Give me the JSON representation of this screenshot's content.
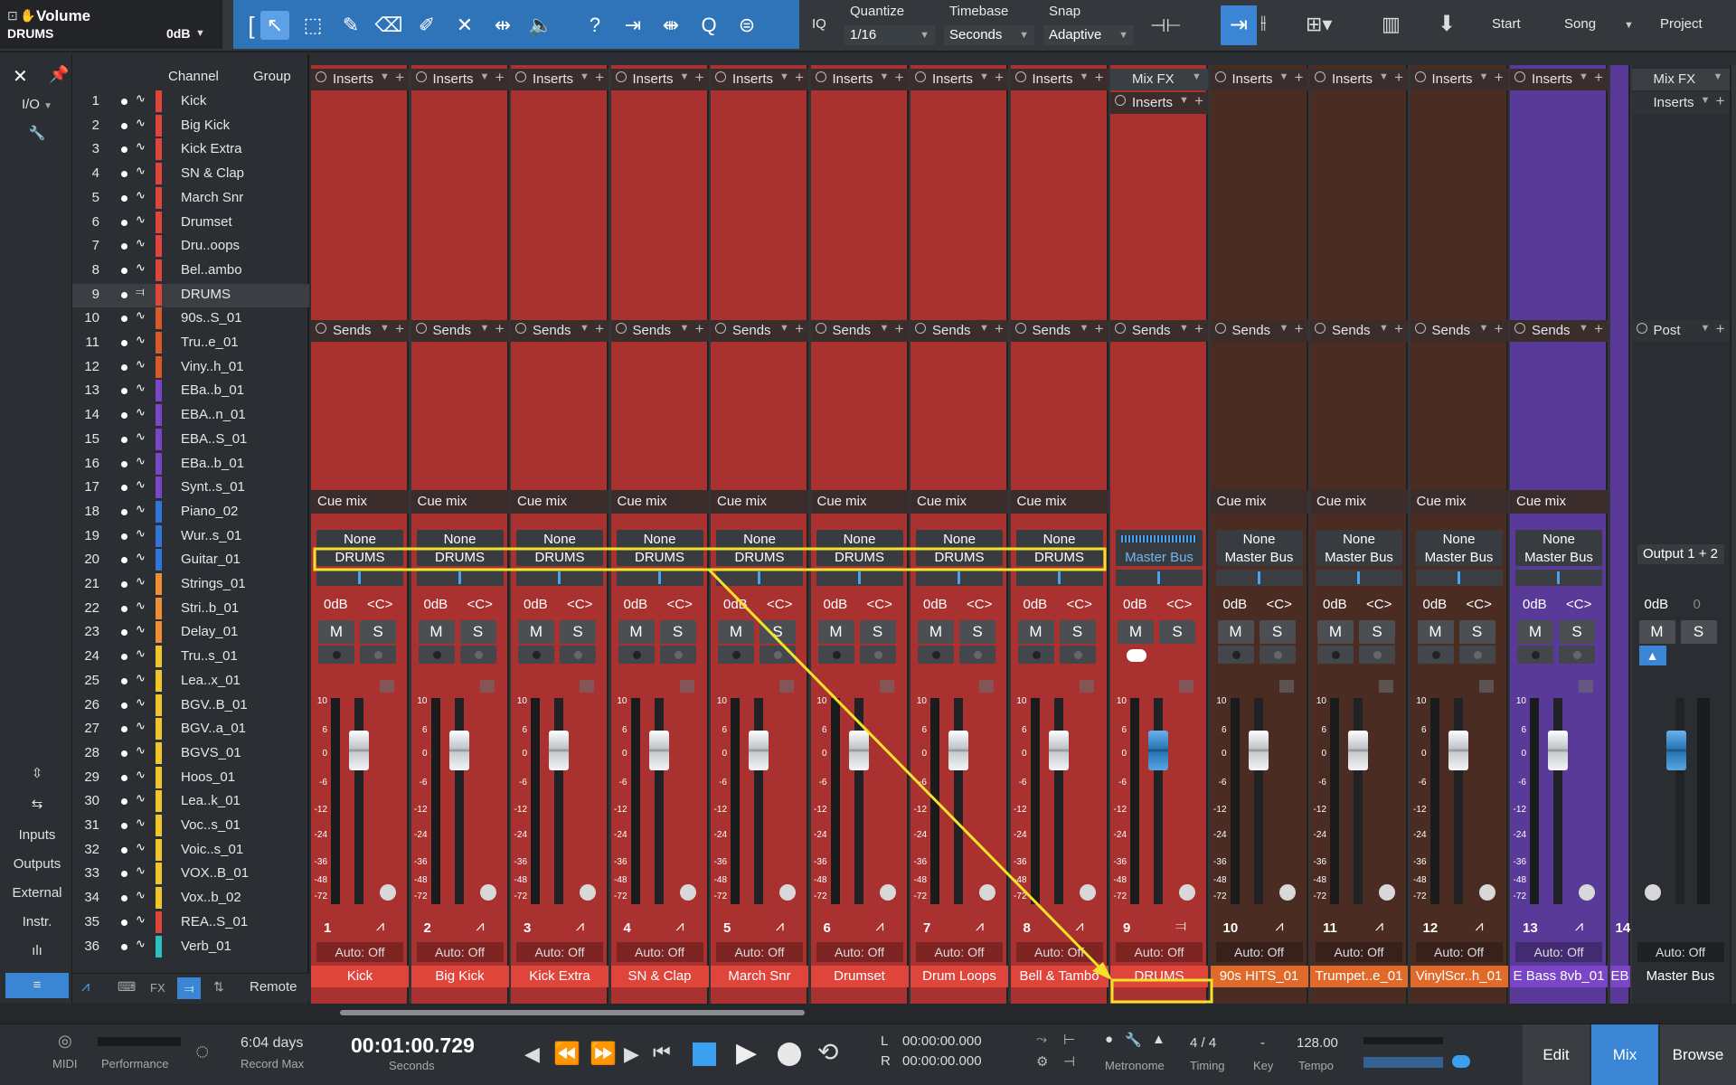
{
  "toolbar": {
    "title": "Volume",
    "track": "DRUMS",
    "value": "0dB",
    "quantize_label": "Quantize",
    "quantize_value": "1/16",
    "timebase_label": "Timebase",
    "timebase_value": "Seconds",
    "snap_label": "Snap",
    "snap_value": "Adaptive",
    "iq": "IQ",
    "start": "Start",
    "song": "Song",
    "project": "Project"
  },
  "left": {
    "io": "I/O",
    "inputs": "Inputs",
    "outputs": "Outputs",
    "external": "External",
    "instr": "Instr.",
    "channel_hdr": "Channel",
    "group_hdr": "Group",
    "remote": "Remote",
    "fx": "FX"
  },
  "channels": [
    {
      "n": "1",
      "name": "Kick",
      "color": "#e0453c"
    },
    {
      "n": "2",
      "name": "Big Kick",
      "color": "#e0453c"
    },
    {
      "n": "3",
      "name": "Kick Extra",
      "color": "#e0453c"
    },
    {
      "n": "4",
      "name": "SN & Clap",
      "color": "#e0453c"
    },
    {
      "n": "5",
      "name": "March Snr",
      "color": "#e0453c"
    },
    {
      "n": "6",
      "name": "Drumset",
      "color": "#e0453c"
    },
    {
      "n": "7",
      "name": "Dru..oops",
      "color": "#e0453c"
    },
    {
      "n": "8",
      "name": "Bel..ambo",
      "color": "#e0453c"
    },
    {
      "n": "9",
      "name": "DRUMS",
      "color": "#e0453c"
    },
    {
      "n": "10",
      "name": "90s..S_01",
      "color": "#d85a2a"
    },
    {
      "n": "11",
      "name": "Tru..e_01",
      "color": "#d85a2a"
    },
    {
      "n": "12",
      "name": "Viny..h_01",
      "color": "#d85a2a"
    },
    {
      "n": "13",
      "name": "EBa..b_01",
      "color": "#7a45c6"
    },
    {
      "n": "14",
      "name": "EBA..n_01",
      "color": "#7a45c6"
    },
    {
      "n": "15",
      "name": "EBA..S_01",
      "color": "#7a45c6"
    },
    {
      "n": "16",
      "name": "EBa..b_01",
      "color": "#7a45c6"
    },
    {
      "n": "17",
      "name": "Synt..s_01",
      "color": "#7a45c6"
    },
    {
      "n": "18",
      "name": "Piano_02",
      "color": "#2f76d8"
    },
    {
      "n": "19",
      "name": "Wur..s_01",
      "color": "#2f76d8"
    },
    {
      "n": "20",
      "name": "Guitar_01",
      "color": "#2f76d8"
    },
    {
      "n": "21",
      "name": "Strings_01",
      "color": "#ef8f35"
    },
    {
      "n": "22",
      "name": "Stri..b_01",
      "color": "#ef8f35"
    },
    {
      "n": "23",
      "name": "Delay_01",
      "color": "#ef8f35"
    },
    {
      "n": "24",
      "name": "Tru..s_01",
      "color": "#f0c628"
    },
    {
      "n": "25",
      "name": "Lea..x_01",
      "color": "#f0c628"
    },
    {
      "n": "26",
      "name": "BGV..B_01",
      "color": "#f0c628"
    },
    {
      "n": "27",
      "name": "BGV..a_01",
      "color": "#f0c628"
    },
    {
      "n": "28",
      "name": "BGVS_01",
      "color": "#f0c628"
    },
    {
      "n": "29",
      "name": "Hoos_01",
      "color": "#f0c628"
    },
    {
      "n": "30",
      "name": "Lea..k_01",
      "color": "#f0c628"
    },
    {
      "n": "31",
      "name": "Voc..s_01",
      "color": "#f0c628"
    },
    {
      "n": "32",
      "name": "Voic..s_01",
      "color": "#f0c628"
    },
    {
      "n": "33",
      "name": "VOX..B_01",
      "color": "#f0c628"
    },
    {
      "n": "34",
      "name": "Vox..b_02",
      "color": "#f0c628"
    },
    {
      "n": "35",
      "name": "REA..S_01",
      "color": "#e0453c"
    },
    {
      "n": "36",
      "name": "Verb_01",
      "color": "#2ec0c0"
    }
  ],
  "strips": [
    {
      "num": "1",
      "name": "Kick",
      "route_a": "None",
      "route_b": "DRUMS",
      "theme": "red",
      "namebg": "#e0453c"
    },
    {
      "num": "2",
      "name": "Big Kick",
      "route_a": "None",
      "route_b": "DRUMS",
      "theme": "red",
      "namebg": "#e0453c"
    },
    {
      "num": "3",
      "name": "Kick Extra",
      "route_a": "None",
      "route_b": "DRUMS",
      "theme": "red",
      "namebg": "#e0453c"
    },
    {
      "num": "4",
      "name": "SN & Clap",
      "route_a": "None",
      "route_b": "DRUMS",
      "theme": "red",
      "namebg": "#e0453c"
    },
    {
      "num": "5",
      "name": "March Snr",
      "route_a": "None",
      "route_b": "DRUMS",
      "theme": "red",
      "namebg": "#e0453c"
    },
    {
      "num": "6",
      "name": "Drumset",
      "route_a": "None",
      "route_b": "DRUMS",
      "theme": "red",
      "namebg": "#e0453c"
    },
    {
      "num": "7",
      "name": "Drum Loops",
      "route_a": "None",
      "route_b": "DRUMS",
      "theme": "red",
      "namebg": "#e0453c"
    },
    {
      "num": "8",
      "name": "Bell & Tambo",
      "route_a": "None",
      "route_b": "DRUMS",
      "theme": "red",
      "namebg": "#e0453c"
    },
    {
      "num": "9",
      "name": "DRUMS",
      "route_a": "",
      "route_b": "Master Bus",
      "theme": "drums",
      "namebg": "#e0453c"
    },
    {
      "num": "10",
      "name": "90s HITS_01",
      "route_a": "None",
      "route_b": "Master Bus",
      "theme": "brown",
      "namebg": "#e06a2a"
    },
    {
      "num": "11",
      "name": "Trumpet..e_01",
      "route_a": "None",
      "route_b": "Master Bus",
      "theme": "brown",
      "namebg": "#e06a2a"
    },
    {
      "num": "12",
      "name": "VinylScr..h_01",
      "route_a": "None",
      "route_b": "Master Bus",
      "theme": "brown",
      "namebg": "#e06a2a"
    },
    {
      "num": "13",
      "name": "E Bass 8vb_01",
      "route_a": "None",
      "route_b": "Master Bus",
      "theme": "purple",
      "namebg": "#7a45c6"
    }
  ],
  "strip_labels": {
    "inserts": "Inserts",
    "sends": "Sends",
    "cue": "Cue mix",
    "mixfx": "Mix FX",
    "vol": "0dB",
    "pan": "<C>",
    "mute": "M",
    "solo": "S",
    "auto": "Auto: Off",
    "post": "Post"
  },
  "master": {
    "name": "Master Bus",
    "output": "Output 1 + 2",
    "vol": "0dB",
    "vol2": "0",
    "partial_num": "14",
    "partial_name": "EB"
  },
  "transport": {
    "midi": "MIDI",
    "performance": "Performance",
    "record_max_val": "6:04 days",
    "record_max": "Record Max",
    "time": "00:01:00.729",
    "time_unit": "Seconds",
    "loop_l": "00:00:00.000",
    "loop_r": "00:00:00.000",
    "L": "L",
    "R": "R",
    "metronome": "Metronome",
    "timing_val": "4 / 4",
    "timing": "Timing",
    "key_val": "-",
    "key": "Key",
    "tempo_val": "128.00",
    "tempo": "Tempo",
    "edit": "Edit",
    "mix": "Mix",
    "browse": "Browse"
  },
  "scale_marks": [
    "10",
    "6",
    "0",
    "-6",
    "-12",
    "-24",
    "-36",
    "-48",
    "-72"
  ]
}
